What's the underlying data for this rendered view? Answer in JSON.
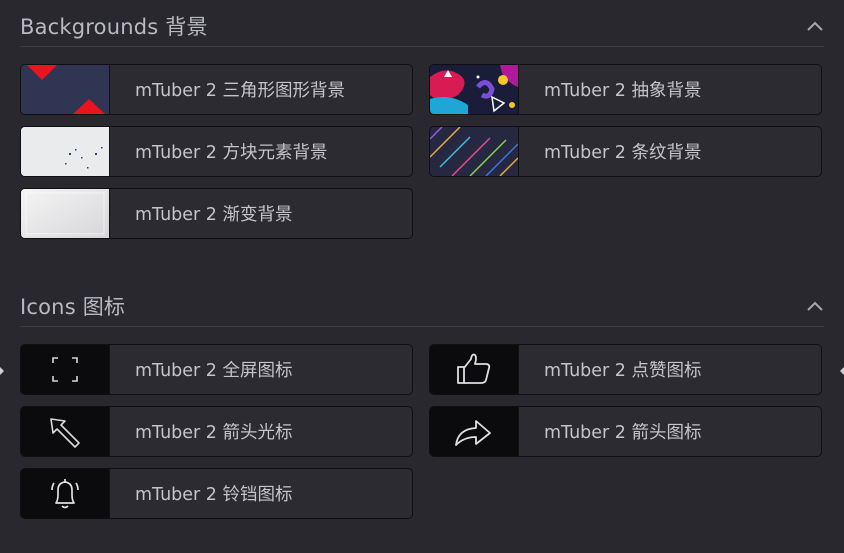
{
  "backgrounds": {
    "title": "Backgrounds 背景",
    "items": [
      {
        "label": "mTuber 2 三角形图形背景"
      },
      {
        "label": "mTuber 2 抽象背景"
      },
      {
        "label": "mTuber 2 方块元素背景"
      },
      {
        "label": "mTuber 2 条纹背景"
      },
      {
        "label": "mTuber 2 渐变背景"
      }
    ]
  },
  "icons": {
    "title": "Icons 图标",
    "items": [
      {
        "label": "mTuber 2 全屏图标",
        "icon": "fullscreen-icon"
      },
      {
        "label": "mTuber 2 点赞图标",
        "icon": "thumbs-up-icon"
      },
      {
        "label": "mTuber 2 箭头光标",
        "icon": "arrow-cursor-icon"
      },
      {
        "label": "mTuber 2 箭头图标",
        "icon": "share-arrow-icon"
      },
      {
        "label": "mTuber 2 铃铛图标",
        "icon": "bell-icon"
      }
    ]
  },
  "colors": {
    "background": "#28282e",
    "item_background": "#2b2b31",
    "text": "#c4c4ca",
    "accent_red": "#e8141e"
  }
}
